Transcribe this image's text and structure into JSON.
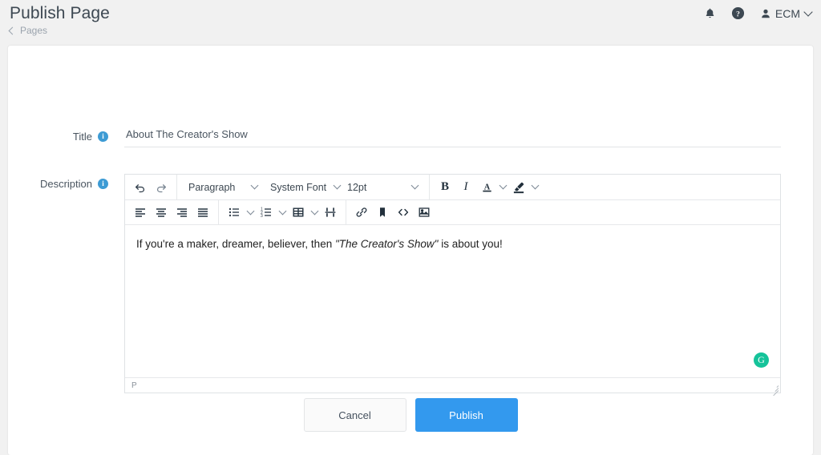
{
  "header": {
    "title": "Publish Page",
    "breadcrumb_label": "Pages",
    "bell_icon": "bell-icon",
    "help_icon": "help-circle-icon",
    "user_icon": "person-icon",
    "user_label": "ECM",
    "accent_color": "#3399ee"
  },
  "form": {
    "title_field": {
      "label": "Title",
      "info_char": "i",
      "value": "About The Creator's Show",
      "placeholder": ""
    },
    "description_field": {
      "label": "Description",
      "info_char": "i"
    }
  },
  "editor": {
    "toolbar_row1": {
      "undo": "undo-icon",
      "redo": "redo-icon",
      "block_format": "Paragraph",
      "font_family": "System Font",
      "font_size": "12pt",
      "bold": "B",
      "italic": "I",
      "text_color": "A",
      "highlight": "highlight-pen"
    },
    "toolbar_row2": {
      "align_left": "align-left-icon",
      "align_center": "align-center-icon",
      "align_right": "align-right-icon",
      "align_justify": "align-justify-icon",
      "bullet_list": "bullet-list-icon",
      "numbered_list": "numbered-list-icon",
      "table": "table-icon",
      "page_break": "page-break-icon",
      "link": "link-icon",
      "bookmark": "bookmark-icon",
      "source_code": "<>",
      "image": "image-icon"
    },
    "content_plain": "If you're a maker, dreamer, believer, then ",
    "content_italic": "\"The Creator's Show\"",
    "content_tail": " is about you!",
    "grammarly_badge": "G",
    "status_path": "P"
  },
  "actions": {
    "cancel_label": "Cancel",
    "publish_label": "Publish"
  }
}
